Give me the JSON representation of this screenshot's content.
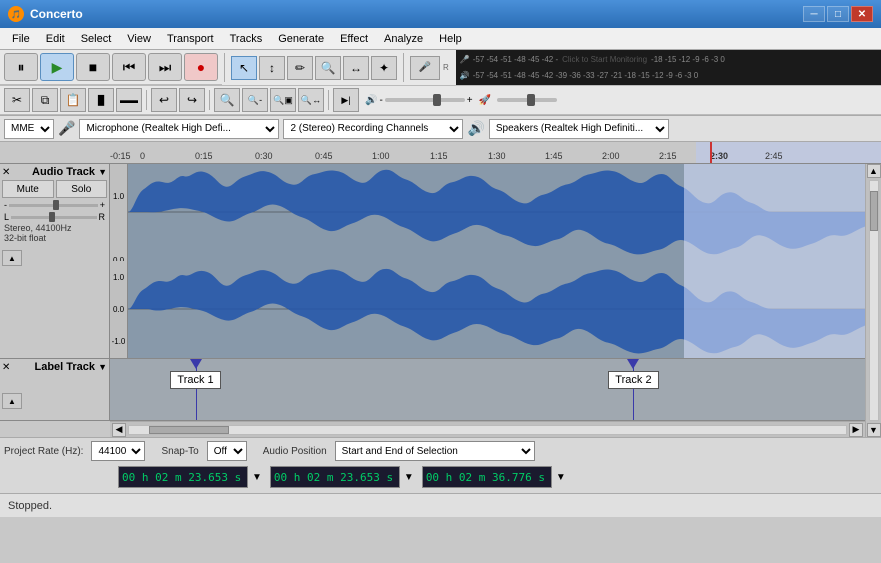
{
  "app": {
    "title": "Concerto",
    "icon": "🎵"
  },
  "titlebar": {
    "title": "Concerto",
    "minimize": "─",
    "maximize": "□",
    "close": "✕"
  },
  "menubar": {
    "items": [
      "File",
      "Edit",
      "Select",
      "View",
      "Transport",
      "Tracks",
      "Generate",
      "Effect",
      "Analyze",
      "Help"
    ]
  },
  "transport": {
    "pause": "⏸",
    "play": "▶",
    "stop": "■",
    "prev": "⏮",
    "next": "⏭",
    "record": "●"
  },
  "tools": {
    "select": "↖",
    "envelope": "↕",
    "draw": "✏",
    "zoom_in": "🔍+",
    "zoom_fit": "↔",
    "multi": "*",
    "record_meter": "🎤",
    "playback_meter": "🔊",
    "cut": "✂",
    "copy": "⧉",
    "paste": "📋",
    "trim": "▐",
    "silence": "▬",
    "undo": "↩",
    "redo": "↪",
    "zoom_in2": "🔍",
    "zoom_out": "🔍-",
    "zoom_sel": "🔍▣",
    "zoom_fit2": "🔍↔",
    "play_cursor": "▶|",
    "vol_down": "-",
    "vol_up": "+"
  },
  "device": {
    "api": "MME",
    "mic_icon": "🎤",
    "microphone": "Microphone (Realtek High Defi...",
    "channels": "2 (Stereo) Recording Channels",
    "speaker_icon": "🔊",
    "speaker": "Speakers (Realtek High Definiti..."
  },
  "ruler": {
    "markers": [
      {
        "time": "-0:15",
        "pos": 0
      },
      {
        "time": "0",
        "pos": 30
      },
      {
        "time": "0:15",
        "pos": 90
      },
      {
        "time": "0:30",
        "pos": 150
      },
      {
        "time": "0:45",
        "pos": 210
      },
      {
        "time": "1:00",
        "pos": 270
      },
      {
        "time": "1:15",
        "pos": 330
      },
      {
        "time": "1:30",
        "pos": 390
      },
      {
        "time": "1:45",
        "pos": 450
      },
      {
        "time": "2:00",
        "pos": 510
      },
      {
        "time": "2:15",
        "pos": 570
      },
      {
        "time": "2:30",
        "pos": 625
      },
      {
        "time": "2:45",
        "pos": 690
      }
    ]
  },
  "audio_track": {
    "name": "Audio Track",
    "close": "✕",
    "expand": "▼",
    "mute": "Mute",
    "solo": "Solo",
    "gain_min": "-",
    "gain_max": "+",
    "pan_l": "L",
    "pan_r": "R",
    "info": "Stereo, 44100Hz\n32-bit float",
    "collapse_icon": "▲",
    "scale_top": "1.0",
    "scale_mid": "0.0",
    "scale_bot": "-1.0",
    "scale_top2": "1.0",
    "scale_mid2": "0.0",
    "scale_bot2": "-1.0"
  },
  "label_track": {
    "name": "Label Track",
    "close": "✕",
    "expand": "▼",
    "collapse_icon": "▲",
    "label1": "Track 1",
    "label2": "Track 2",
    "label1_pos_pct": 8,
    "label2_pos_pct": 66
  },
  "statusbar": {
    "text": "Stopped."
  },
  "bottombar": {
    "project_rate_label": "Project Rate (Hz):",
    "project_rate": "44100",
    "snap_to_label": "Snap-To",
    "snap_to": "Off",
    "audio_position_label": "Audio Position",
    "selection_label": "Start and End of Selection",
    "time1": "0 0 h 0 2 m 2 3 . 6 5 3 s",
    "time2": "0 0 h 0 2 m 2 3 . 6 5 3 s",
    "time3": "0 0 h 0 2 m 3 6 . 7 7 6 s",
    "time1_display": "00 h 02 m 23.653 s",
    "time2_display": "00 h 02 m 23.653 s",
    "time3_display": "00 h 02 m 36.776 s"
  }
}
